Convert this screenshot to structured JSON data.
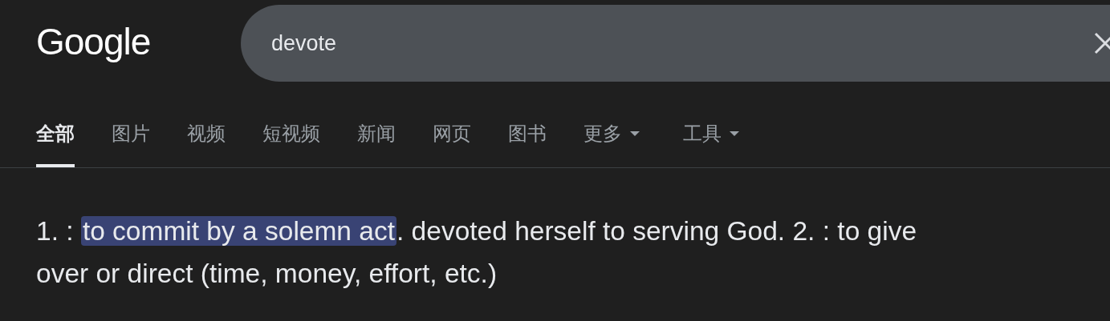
{
  "logo": {
    "text": "Google"
  },
  "search": {
    "value": "devote"
  },
  "tabs": [
    {
      "label": "全部",
      "selected": true,
      "has_menu": false
    },
    {
      "label": "图片",
      "selected": false,
      "has_menu": false
    },
    {
      "label": "视频",
      "selected": false,
      "has_menu": false
    },
    {
      "label": "短视频",
      "selected": false,
      "has_menu": false
    },
    {
      "label": "新闻",
      "selected": false,
      "has_menu": false
    },
    {
      "label": "网页",
      "selected": false,
      "has_menu": false
    },
    {
      "label": "图书",
      "selected": false,
      "has_menu": false
    },
    {
      "label": "更多",
      "selected": false,
      "has_menu": true
    },
    {
      "label": "工具",
      "selected": false,
      "has_menu": true
    }
  ],
  "definition": [
    {
      "text": "1. : ",
      "highlighted": false
    },
    {
      "text": "to commit by a solemn act",
      "highlighted": true
    },
    {
      "text": ". devoted herself to serving God. 2. : to give over or direct (time, money, effort, etc.)",
      "highlighted": false
    }
  ]
}
